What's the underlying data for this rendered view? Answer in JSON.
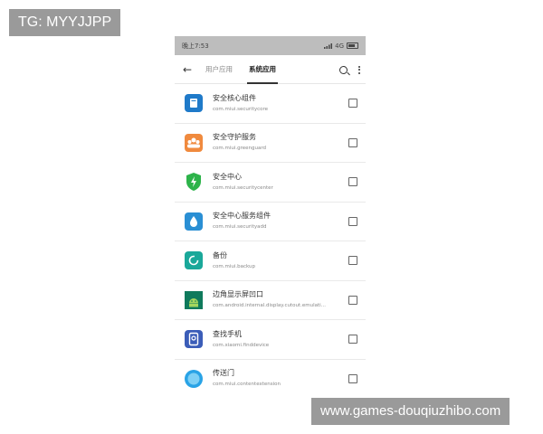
{
  "watermarks": {
    "top_left": "TG: MYYJJPP",
    "bottom_right": "www.games-douqiuzhibo.com"
  },
  "status_bar": {
    "time": "晚上7:53",
    "network": "4G",
    "signal_icon": "signal-icon",
    "battery_icon": "battery-icon"
  },
  "header": {
    "back_icon": "arrow-left-icon",
    "tabs": [
      {
        "label": "用户应用",
        "active": false
      },
      {
        "label": "系统应用",
        "active": true
      }
    ],
    "search_icon": "search-icon",
    "more_icon": "more-vertical-icon"
  },
  "apps": [
    {
      "name": "安全核心组件",
      "package": "com.miui.securitycore",
      "icon": "security-core-icon",
      "color": "#1f7ac9",
      "checked": false
    },
    {
      "name": "安全守护服务",
      "package": "com.miui.greenguard",
      "icon": "greenguard-icon",
      "color": "#f08a3e",
      "checked": false
    },
    {
      "name": "安全中心",
      "package": "com.miui.securitycenter",
      "icon": "security-center-icon",
      "color": "#2db34a",
      "checked": false
    },
    {
      "name": "安全中心服务组件",
      "package": "com.miui.securityadd",
      "icon": "security-add-icon",
      "color": "#2a8fd4",
      "checked": false
    },
    {
      "name": "备份",
      "package": "com.miui.backup",
      "icon": "backup-icon",
      "color": "#1aa89a",
      "checked": false
    },
    {
      "name": "边角显示屏凹口",
      "package": "com.android.internal.display.cutout.emulati...",
      "icon": "android-icon",
      "color": "#0f7a5c",
      "checked": false
    },
    {
      "name": "查找手机",
      "package": "com.xiaomi.finddevice",
      "icon": "find-device-icon",
      "color": "#3b5db8",
      "checked": false
    },
    {
      "name": "传送门",
      "package": "com.miui.contentextension",
      "icon": "content-extension-icon",
      "color": "#29a3e6",
      "checked": false
    }
  ]
}
